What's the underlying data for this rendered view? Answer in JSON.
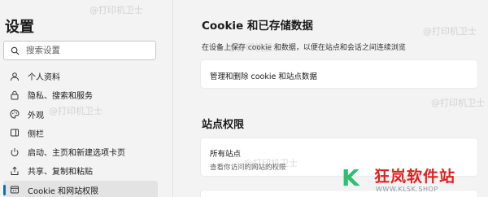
{
  "sidebar": {
    "title": "设置",
    "search_placeholder": "搜索设置",
    "items": [
      {
        "label": "个人资料",
        "icon": "profile-icon"
      },
      {
        "label": "隐私、搜索和服务",
        "icon": "lock-icon"
      },
      {
        "label": "外观",
        "icon": "palette-icon"
      },
      {
        "label": "侧栏",
        "icon": "sidebar-icon"
      },
      {
        "label": "启动、主页和新建选项卡页",
        "icon": "power-icon"
      },
      {
        "label": "共享、复制和粘贴",
        "icon": "share-icon"
      },
      {
        "label": "Cookie 和网站权限",
        "icon": "cookie-permissions-icon",
        "active": true
      }
    ]
  },
  "main": {
    "heading": "Cookie 和已存储数据",
    "description": "在设备上保存 cookie 和数据，以便在站点和会话之间连续浏览",
    "manage_cookies_label": "管理和删除 cookie 和站点数据",
    "site_permissions_heading": "站点权限",
    "all_sites": {
      "title": "所有站点",
      "subtitle": "查看你访问的网站的权限"
    }
  },
  "watermark": "@打印机卫士",
  "brand": {
    "name": "狂岚软件站",
    "url": "WWW.KLSK.SHOP",
    "accent": "#0f6cbd"
  }
}
